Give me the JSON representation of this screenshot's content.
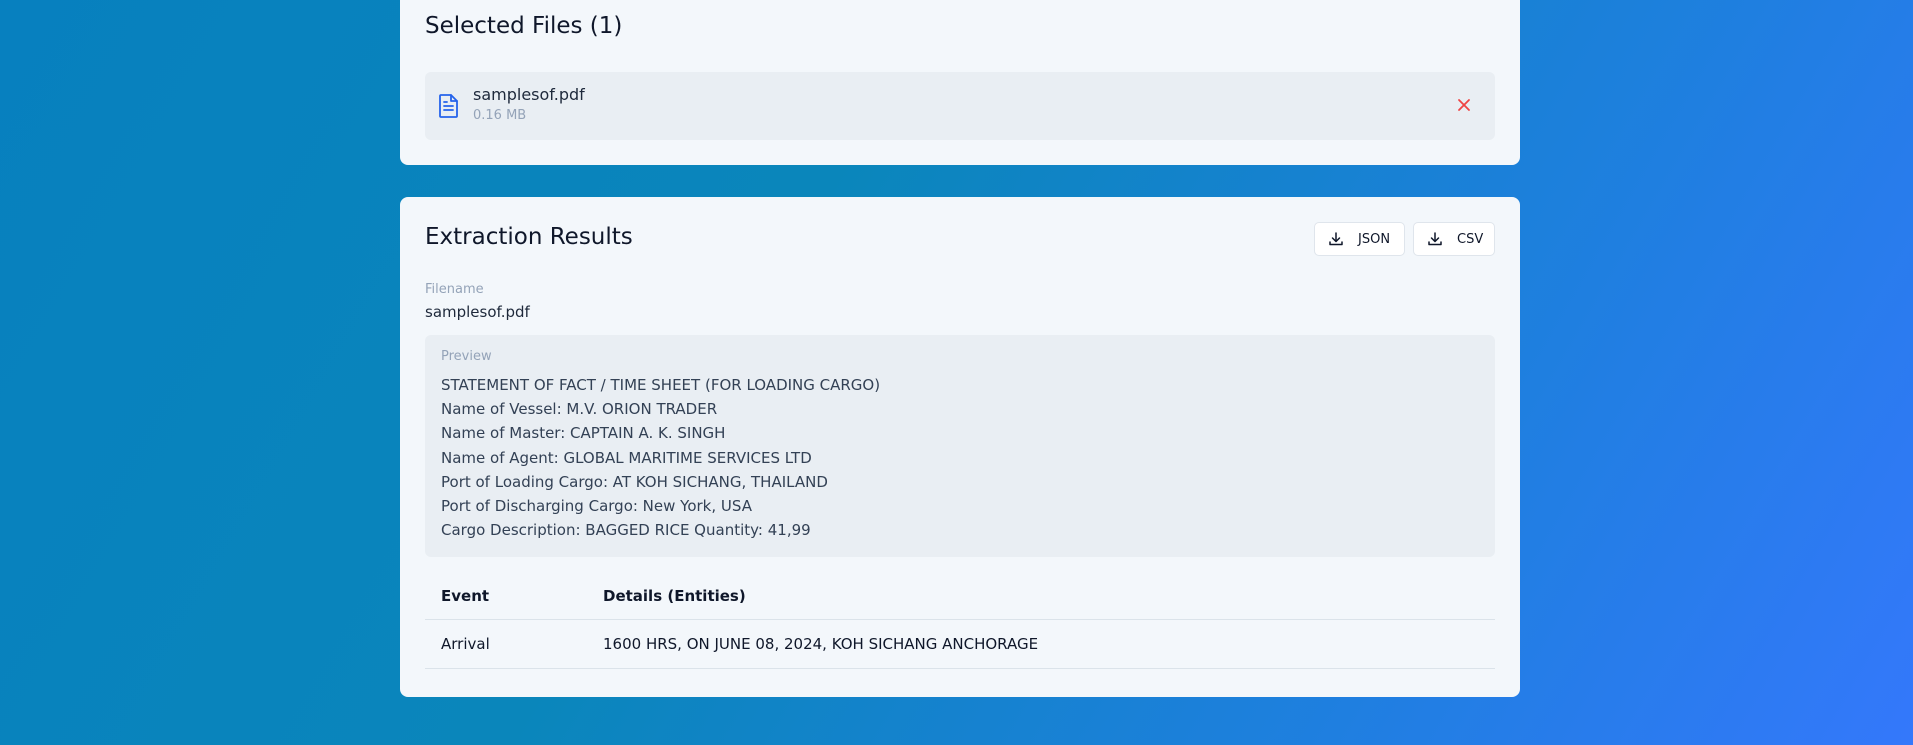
{
  "selected_files": {
    "title": "Selected Files (1)",
    "files": [
      {
        "name": "samplesof.pdf",
        "size": "0.16 MB",
        "icon": "file-text-icon"
      }
    ],
    "remove_icon": "close-icon",
    "remove_color": "#ef4444"
  },
  "results": {
    "title": "Extraction Results",
    "buttons": {
      "json_label": "JSON",
      "csv_label": "CSV",
      "icon": "download-icon"
    },
    "filename_label": "Filename",
    "filename_value": "samplesof.pdf",
    "preview": {
      "label": "Preview",
      "lines": [
        "STATEMENT OF FACT / TIME SHEET (FOR LOADING CARGO)",
        "Name of Vessel: M.V. ORION TRADER",
        "Name of Master: CAPTAIN A. K. SINGH",
        "Name of Agent: GLOBAL MARITIME SERVICES LTD",
        "Port of Loading Cargo: AT KOH SICHANG, THAILAND",
        "Port of Discharging Cargo: New York, USA",
        "Cargo Description: BAGGED RICE Quantity: 41,99"
      ]
    },
    "table": {
      "headers": [
        "Event",
        "Details (Entities)"
      ],
      "rows": [
        [
          "Arrival",
          "1600 HRS, ON JUNE 08, 2024, KOH SICHANG ANCHORAGE"
        ]
      ]
    }
  },
  "colors": {
    "accent": "#2563eb",
    "card_bg": "#f3f7fb",
    "danger": "#ef4444"
  }
}
